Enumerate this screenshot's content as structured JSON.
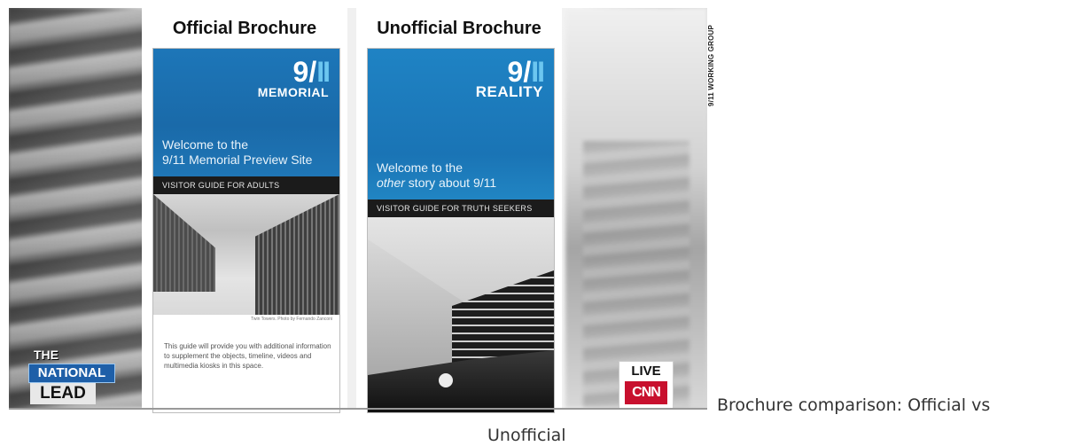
{
  "still": {
    "official": {
      "title": "Official Brochure",
      "logo_num": "9/",
      "logo_bars": "II",
      "logo_word": "MEMORIAL",
      "welcome_line1": "Welcome to the",
      "welcome_line2": "9/11 Memorial Preview Site",
      "guide": "VISITOR GUIDE FOR ADULTS",
      "photo_caption": "Twin Towers. Photo by Fernando Zanconi",
      "body": "This guide will provide you with additional information to supplement the objects, timeline, videos and multimedia kiosks in this space."
    },
    "unofficial": {
      "title": "Unofficial Brochure",
      "logo_num": "9/",
      "logo_bars": "II",
      "logo_word": "REALITY",
      "welcome_line1": "Welcome to the",
      "welcome_other": "other",
      "welcome_line2_rest": " story about 9/11",
      "guide": "VISITOR GUIDE FOR TRUTH SEEKERS"
    },
    "credit": "9/11 WORKING GROUP",
    "bug_the": "THE",
    "bug_national": "NATIONAL",
    "bug_lead": "LEAD",
    "bug_live": "LIVE",
    "bug_cnn": "CNN"
  },
  "caption_line1": "Brochure comparison: Official vs",
  "caption_line2": "Unofficial"
}
